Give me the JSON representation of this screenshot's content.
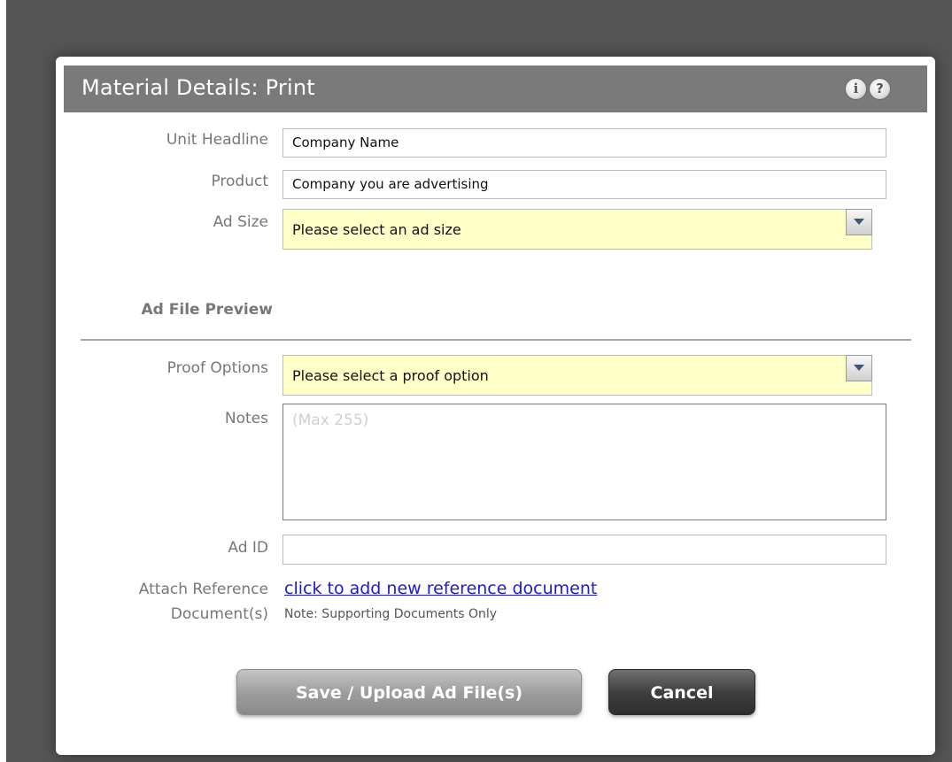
{
  "dialog": {
    "title": "Material Details: Print",
    "info_icon_glyph": "i",
    "help_icon_glyph": "?",
    "icons": [
      "info-icon",
      "help-icon",
      "chevron-down-icon"
    ]
  },
  "form": {
    "unit_headline": {
      "label": "Unit Headline",
      "value": "Company Name"
    },
    "product": {
      "label": "Product",
      "value": "Company you are advertising"
    },
    "ad_size": {
      "label": "Ad Size",
      "selected": "Please select an ad size"
    },
    "ad_file_preview": {
      "label": "Ad File Preview"
    },
    "proof_options": {
      "label": "Proof Options",
      "selected": "Please select a proof option"
    },
    "notes": {
      "label": "Notes",
      "placeholder": "(Max 255)"
    },
    "ad_id": {
      "label": "Ad ID",
      "value": ""
    },
    "attach_reference": {
      "label_line1": "Attach Reference",
      "label_line2": "Document(s)",
      "link_text": "click to add new reference document",
      "note": "Note: Supporting Documents Only"
    }
  },
  "buttons": {
    "save_label": "Save / Upload Ad File(s)",
    "cancel_label": "Cancel"
  },
  "colors": {
    "backdrop": "#555555",
    "header_bg": "#7a7a7a",
    "select_bg": "#ffffc8",
    "link": "#1a1adc"
  }
}
